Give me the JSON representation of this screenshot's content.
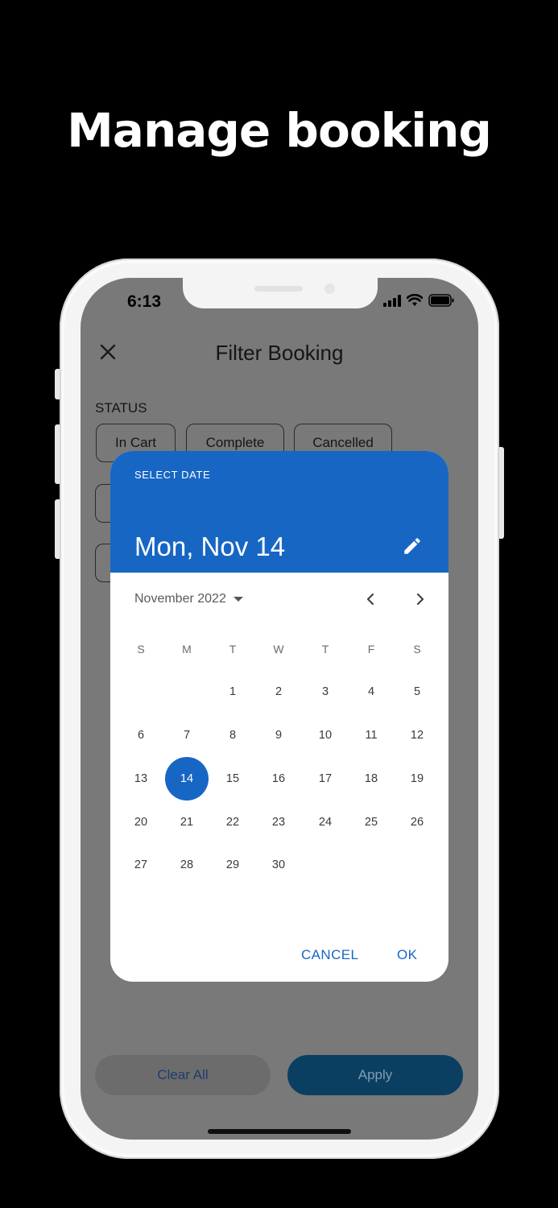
{
  "headline": "Manage booking",
  "status_bar": {
    "time": "6:13"
  },
  "filter_page": {
    "title": "Filter Booking",
    "section_status": "STATUS",
    "chips": [
      "In Cart",
      "Complete",
      "Cancelled"
    ],
    "clear_label": "Clear All",
    "apply_label": "Apply"
  },
  "date_picker": {
    "header_label": "SELECT DATE",
    "selected_date_text": "Mon, Nov 14",
    "month_label": "November 2022",
    "weekdays": [
      "S",
      "M",
      "T",
      "W",
      "T",
      "F",
      "S"
    ],
    "weeks": [
      [
        "",
        "",
        "1",
        "2",
        "3",
        "4",
        "5"
      ],
      [
        "6",
        "7",
        "8",
        "9",
        "10",
        "11",
        "12"
      ],
      [
        "13",
        "14",
        "15",
        "16",
        "17",
        "18",
        "19"
      ],
      [
        "20",
        "21",
        "22",
        "23",
        "24",
        "25",
        "26"
      ],
      [
        "27",
        "28",
        "29",
        "30",
        "",
        "",
        ""
      ]
    ],
    "selected_day": "14",
    "cancel_label": "CANCEL",
    "ok_label": "OK"
  },
  "colors": {
    "accent": "#1766c4",
    "scrim": "#797979",
    "apply_button": "#0b3f61"
  }
}
